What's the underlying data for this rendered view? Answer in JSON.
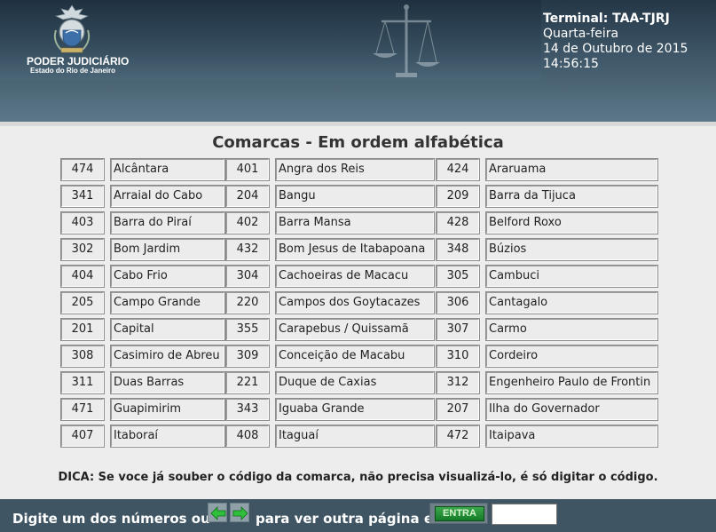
{
  "header": {
    "org_name": "PODER JUDICIÁRIO",
    "org_subtitle": "Estado do Rio de Janeiro",
    "terminal": "Terminal: TAA-TJRJ",
    "weekday": "Quarta-feira",
    "date": "14 de Outubro de 2015",
    "time": "14:56:15"
  },
  "main": {
    "heading": "Comarcas - Em ordem alfabética",
    "rows": [
      [
        {
          "code": "474",
          "name": "Alcântara"
        },
        {
          "code": "401",
          "name": "Angra dos Reis"
        },
        {
          "code": "424",
          "name": "Araruama"
        }
      ],
      [
        {
          "code": "341",
          "name": "Arraial do Cabo"
        },
        {
          "code": "204",
          "name": "Bangu"
        },
        {
          "code": "209",
          "name": "Barra da Tijuca"
        }
      ],
      [
        {
          "code": "403",
          "name": "Barra do Piraí"
        },
        {
          "code": "402",
          "name": "Barra Mansa"
        },
        {
          "code": "428",
          "name": "Belford Roxo"
        }
      ],
      [
        {
          "code": "302",
          "name": "Bom Jardim"
        },
        {
          "code": "432",
          "name": "Bom Jesus de Itabapoana"
        },
        {
          "code": "348",
          "name": "Búzios"
        }
      ],
      [
        {
          "code": "404",
          "name": "Cabo Frio"
        },
        {
          "code": "304",
          "name": "Cachoeiras de Macacu"
        },
        {
          "code": "305",
          "name": "Cambuci"
        }
      ],
      [
        {
          "code": "205",
          "name": "Campo Grande"
        },
        {
          "code": "220",
          "name": "Campos dos Goytacazes"
        },
        {
          "code": "306",
          "name": "Cantagalo"
        }
      ],
      [
        {
          "code": "201",
          "name": "Capital"
        },
        {
          "code": "355",
          "name": "Carapebus / Quissamã"
        },
        {
          "code": "307",
          "name": "Carmo"
        }
      ],
      [
        {
          "code": "308",
          "name": "Casimiro de Abreu"
        },
        {
          "code": "309",
          "name": "Conceição de Macabu"
        },
        {
          "code": "310",
          "name": "Cordeiro"
        }
      ],
      [
        {
          "code": "311",
          "name": "Duas Barras"
        },
        {
          "code": "221",
          "name": "Duque de Caxias"
        },
        {
          "code": "312",
          "name": "Engenheiro Paulo de Frontin"
        }
      ],
      [
        {
          "code": "471",
          "name": "Guapimirim"
        },
        {
          "code": "343",
          "name": "Iguaba Grande"
        },
        {
          "code": "207",
          "name": "Ilha do Governador"
        }
      ],
      [
        {
          "code": "407",
          "name": "Itaboraí"
        },
        {
          "code": "408",
          "name": "Itaguaí"
        },
        {
          "code": "472",
          "name": "Itaipava"
        }
      ]
    ],
    "tip": "DICA: Se voce já souber o código da comarca, não precisa visualizá-lo, é só digitar o código."
  },
  "footer": {
    "text_before_arrows": "Digite um dos números ou",
    "text_after_arrows": "para ver outra página e",
    "enter_label": "ENTRA",
    "code_input_value": ""
  },
  "colors": {
    "header_dark": "#243747",
    "footer_bg": "#3f5563",
    "enter_green": "#157a28",
    "arrow_green": "#2fbf3a"
  },
  "icons": {
    "prev": "left-arrow-icon",
    "next": "right-arrow-icon",
    "emblem": "coat-of-arms-icon",
    "background_art": "scales-of-justice-icon"
  }
}
